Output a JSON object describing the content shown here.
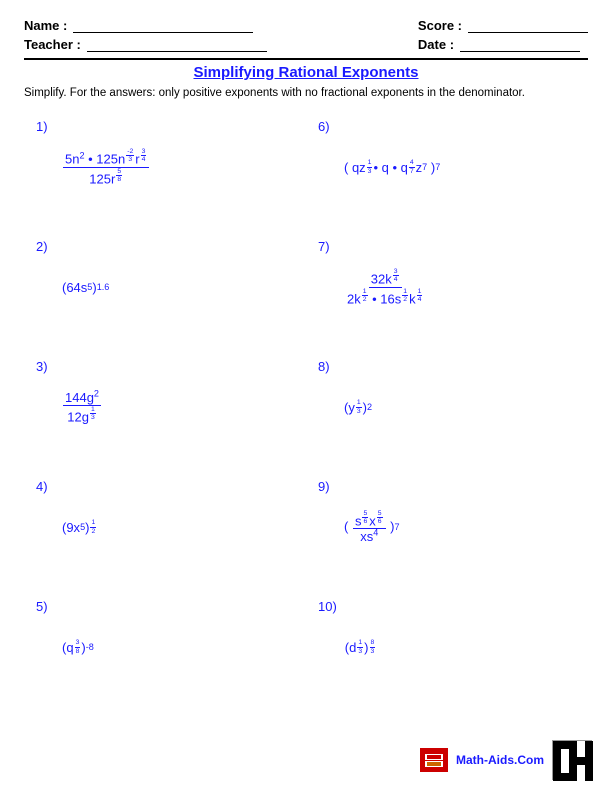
{
  "header": {
    "name_label": "Name :",
    "teacher_label": "Teacher :",
    "score_label": "Score :",
    "date_label": "Date :"
  },
  "title": "Simplifying Rational Exponents",
  "instructions": "Simplify. For the answers: only positive exponents with no fractional exponents in the denominator.",
  "problems": [
    {
      "number": "1)",
      "id": "p1"
    },
    {
      "number": "2)",
      "id": "p2"
    },
    {
      "number": "3)",
      "id": "p3"
    },
    {
      "number": "4)",
      "id": "p4"
    },
    {
      "number": "5)",
      "id": "p5"
    },
    {
      "number": "6)",
      "id": "p6"
    },
    {
      "number": "7)",
      "id": "p7"
    },
    {
      "number": "8)",
      "id": "p8"
    },
    {
      "number": "9)",
      "id": "p9"
    },
    {
      "number": "10)",
      "id": "p10"
    }
  ],
  "footer": {
    "site": "Math-Aids.Com"
  }
}
